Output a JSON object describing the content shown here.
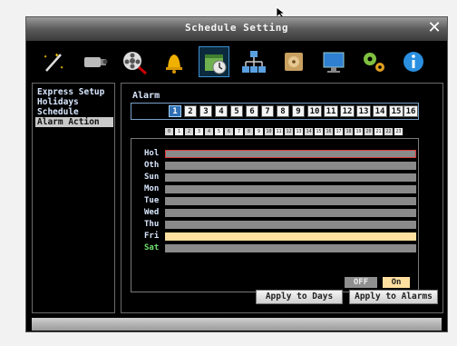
{
  "window": {
    "title": "Schedule Setting",
    "close_glyph": "✕"
  },
  "toolbar": {
    "icons": [
      "magic-wand-icon",
      "camera-icon",
      "film-reel-icon",
      "bell-icon",
      "calendar-check-icon",
      "network-icon",
      "hdd-icon",
      "monitor-icon",
      "gears-icon",
      "info-icon"
    ],
    "selected": "calendar-check-icon"
  },
  "sidebar": {
    "items": [
      {
        "label": "Express Setup",
        "selected": false
      },
      {
        "label": "Holidays",
        "selected": false
      },
      {
        "label": "Schedule",
        "selected": false
      },
      {
        "label": "Alarm Action",
        "selected": true
      }
    ]
  },
  "alarm": {
    "label": "Alarm",
    "numbers": [
      "1",
      "2",
      "3",
      "4",
      "5",
      "6",
      "7",
      "8",
      "9",
      "10",
      "11",
      "12",
      "13",
      "14",
      "15",
      "16"
    ],
    "selected": "1"
  },
  "hours": [
    "0",
    "1",
    "2",
    "3",
    "4",
    "5",
    "6",
    "7",
    "8",
    "9",
    "10",
    "11",
    "12",
    "13",
    "14",
    "15",
    "16",
    "17",
    "18",
    "19",
    "20",
    "21",
    "22",
    "23"
  ],
  "days": [
    {
      "label": "Hol",
      "state": "highlight"
    },
    {
      "label": "Oth",
      "state": "normal"
    },
    {
      "label": "Sun",
      "state": "normal"
    },
    {
      "label": "Mon",
      "state": "normal"
    },
    {
      "label": "Tue",
      "state": "normal"
    },
    {
      "label": "Wed",
      "state": "normal"
    },
    {
      "label": "Thu",
      "state": "normal"
    },
    {
      "label": "Fri",
      "state": "on"
    },
    {
      "label": "Sat",
      "state": "normal"
    }
  ],
  "toggle": {
    "off_label": "OFF",
    "on_label": "On"
  },
  "buttons": {
    "apply_days": "Apply to Days",
    "apply_alarms": "Apply to Alarms"
  },
  "colors": {
    "accent": "#2f6fb2",
    "on_fill": "#ffe0a0",
    "off_fill": "#8a8a8a",
    "highlight_border": "#d93b3b"
  }
}
